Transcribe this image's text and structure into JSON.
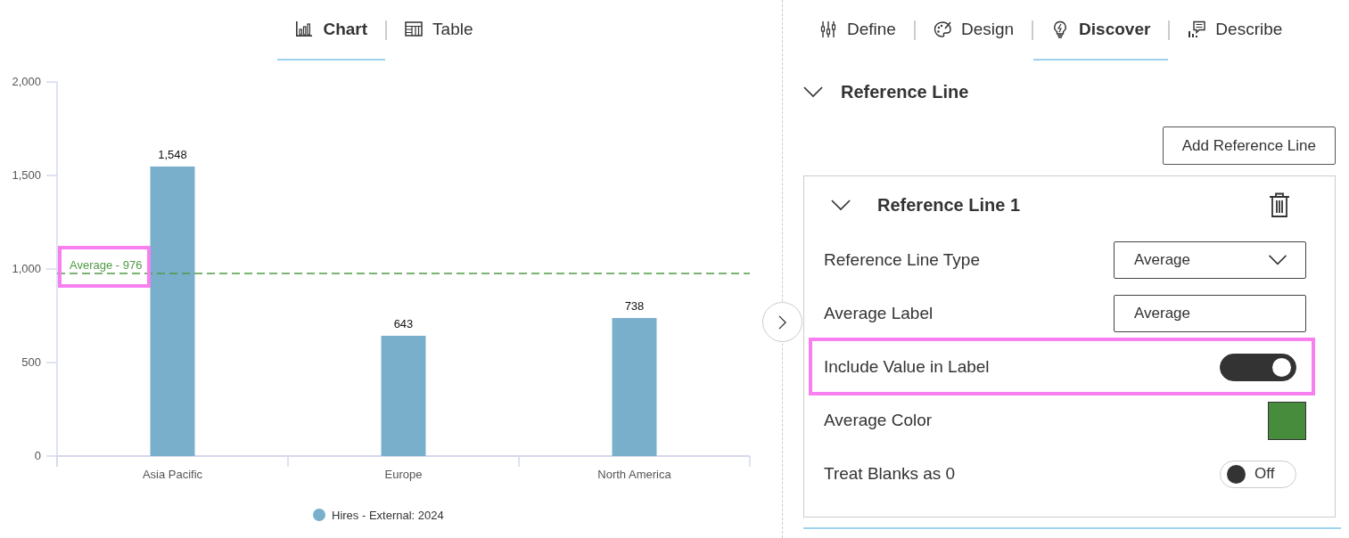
{
  "view_tabs": [
    {
      "label": "Chart",
      "selected": true
    },
    {
      "label": "Table",
      "selected": false
    }
  ],
  "chart": {
    "chart_data": {
      "type": "bar",
      "categories": [
        "Asia Pacific",
        "Europe",
        "North America"
      ],
      "series": [
        {
          "name": "Hires - External: 2024",
          "color": "#7aafcc",
          "values": [
            1548,
            643,
            738
          ]
        }
      ],
      "ylim": [
        0,
        2000
      ],
      "yticks": [
        {
          "value": 0,
          "label": "0"
        },
        {
          "value": 500,
          "label": "500"
        },
        {
          "value": 1000,
          "label": "1,000"
        },
        {
          "value": 1500,
          "label": "1,500"
        },
        {
          "value": 2000,
          "label": "2,000"
        }
      ],
      "value_labels": [
        "1,548",
        "643",
        "738"
      ],
      "ref_lines": [
        {
          "axis": "y",
          "value": 976,
          "label": "Average - 976",
          "color": "#4f9a44"
        }
      ]
    },
    "average_label_highlighted": true
  },
  "panel_tabs": [
    {
      "label": "Define",
      "selected": false
    },
    {
      "label": "Design",
      "selected": false
    },
    {
      "label": "Discover",
      "selected": true
    },
    {
      "label": "Describe",
      "selected": false
    }
  ],
  "reference_line": {
    "title": "Reference Line",
    "expanded": true,
    "add_button": "Add Reference Line",
    "items": [
      {
        "title": "Reference Line 1",
        "expanded": true,
        "fields": [
          {
            "kind": "select",
            "label": "Reference Line Type",
            "value": "Average"
          },
          {
            "kind": "text",
            "label": "Average Label",
            "value": "Average"
          },
          {
            "kind": "toggle",
            "label": "Include Value in Label",
            "on": true,
            "highlighted": true
          },
          {
            "kind": "color",
            "label": "Average Color",
            "color": "#468c3c"
          },
          {
            "kind": "toggle",
            "label": "Treat Blanks as 0",
            "on": false,
            "state_text": "Off"
          }
        ]
      }
    ]
  }
}
